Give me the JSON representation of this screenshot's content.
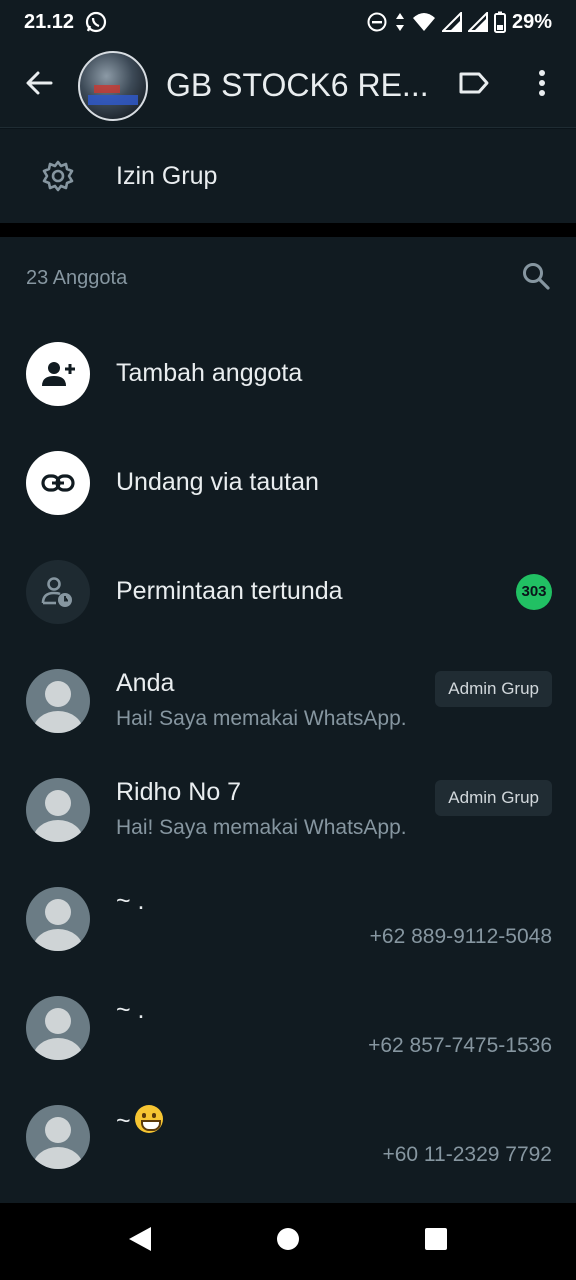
{
  "status_bar": {
    "time": "21.12",
    "battery": "29%"
  },
  "header": {
    "title": "GB STOCK6 RE..."
  },
  "permissions": {
    "label": "Izin Grup"
  },
  "members_section": {
    "count_label": "23 Anggota",
    "actions": {
      "add": "Tambah anggota",
      "invite": "Undang via tautan",
      "pending": "Permintaan tertunda",
      "pending_count": "303"
    },
    "members": [
      {
        "name": "Anda",
        "status": "Hai! Saya memakai WhatsApp.",
        "role": "Admin Grup"
      },
      {
        "name": "Ridho No 7",
        "status": "Hai! Saya memakai WhatsApp.",
        "role": "Admin Grup"
      },
      {
        "name": "~ .",
        "phone": "+62 889-9112-5048"
      },
      {
        "name": "~ .",
        "phone": "+62 857-7475-1536"
      },
      {
        "name": "~",
        "phone": "+60 11-2329 7792"
      }
    ]
  },
  "colors": {
    "background": "#111b21",
    "text_primary": "#e9edef",
    "text_secondary": "#8696a0",
    "accent_green": "#21c063"
  },
  "icons": [
    "whatsapp-icon",
    "dnd-icon",
    "data-arrows-icon",
    "wifi-icon",
    "signal-icon",
    "battery-icon",
    "back-arrow-icon",
    "label-icon",
    "more-vert-icon",
    "gear-icon",
    "search-icon",
    "add-person-icon",
    "link-icon",
    "pending-person-clock-icon",
    "grinning-face-emoji",
    "back-triangle-icon",
    "home-circle-icon",
    "recents-square-icon"
  ]
}
